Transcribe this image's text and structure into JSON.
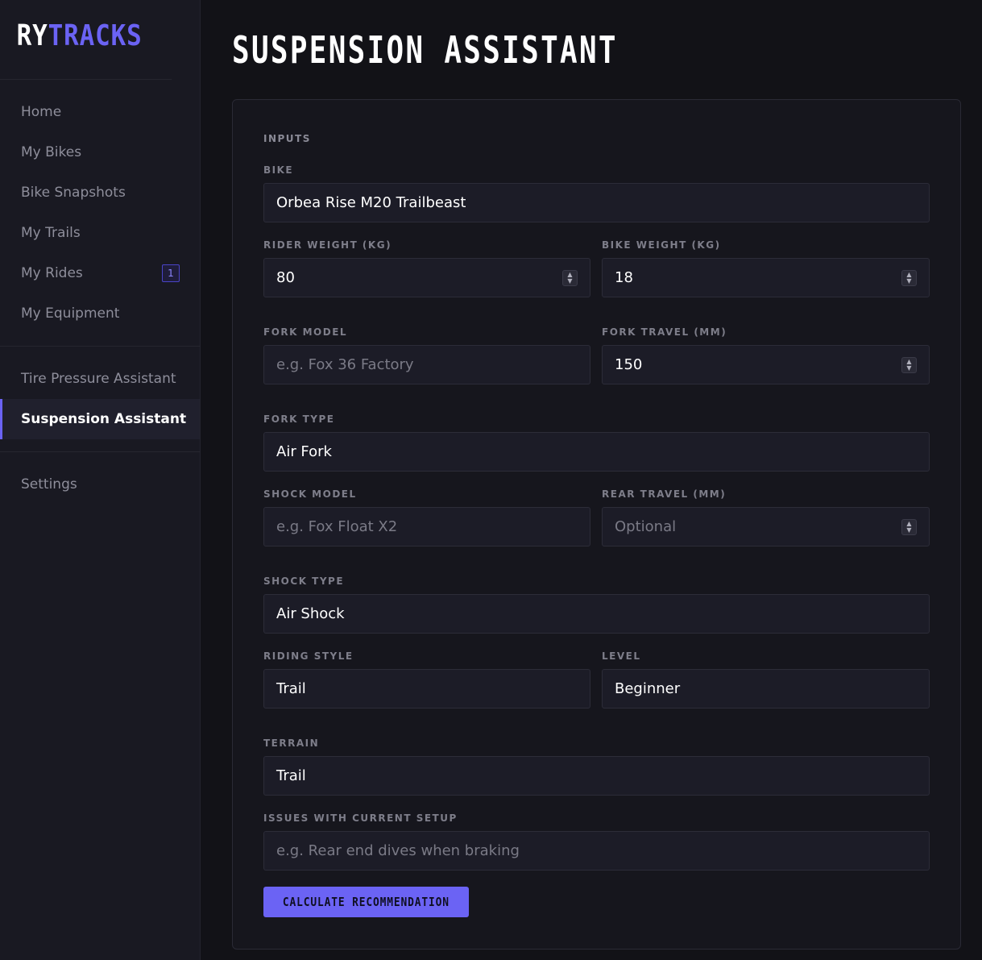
{
  "brand": {
    "part1": "RY",
    "part2": "TRACKS"
  },
  "nav": {
    "group1": [
      {
        "label": "Home"
      },
      {
        "label": "My Bikes"
      },
      {
        "label": "Bike Snapshots"
      },
      {
        "label": "My Trails"
      },
      {
        "label": "My Rides",
        "badge": "1"
      },
      {
        "label": "My Equipment"
      }
    ],
    "group2": [
      {
        "label": "Tire Pressure Assistant"
      },
      {
        "label": "Suspension Assistant",
        "active": true
      }
    ],
    "group3": [
      {
        "label": "Settings"
      }
    ]
  },
  "page": {
    "title": "SUSPENSION ASSISTANT"
  },
  "form": {
    "section": "INPUTS",
    "bike": {
      "label": "BIKE",
      "value": "Orbea Rise M20 Trailbeast"
    },
    "rider_weight": {
      "label": "RIDER WEIGHT (KG)",
      "value": "80"
    },
    "bike_weight": {
      "label": "BIKE WEIGHT (KG)",
      "value": "18"
    },
    "fork_model": {
      "label": "FORK MODEL",
      "value": "",
      "placeholder": "e.g. Fox 36 Factory"
    },
    "fork_travel": {
      "label": "FORK TRAVEL (MM)",
      "value": "150"
    },
    "fork_type": {
      "label": "FORK TYPE",
      "value": "Air Fork"
    },
    "shock_model": {
      "label": "SHOCK MODEL",
      "value": "",
      "placeholder": "e.g. Fox Float X2"
    },
    "rear_travel": {
      "label": "REAR TRAVEL (MM)",
      "value": "",
      "placeholder": "Optional"
    },
    "shock_type": {
      "label": "SHOCK TYPE",
      "value": "Air Shock"
    },
    "riding_style": {
      "label": "RIDING STYLE",
      "value": "Trail"
    },
    "level": {
      "label": "LEVEL",
      "value": "Beginner"
    },
    "terrain": {
      "label": "TERRAIN",
      "value": "Trail"
    },
    "issues": {
      "label": "ISSUES WITH CURRENT SETUP",
      "value": "",
      "placeholder": "e.g. Rear end dives when braking"
    },
    "submit_label": "CALCULATE RECOMMENDATION"
  },
  "colors": {
    "accent": "#6b63f4",
    "background": "#121217",
    "sidebar": "#191922"
  }
}
